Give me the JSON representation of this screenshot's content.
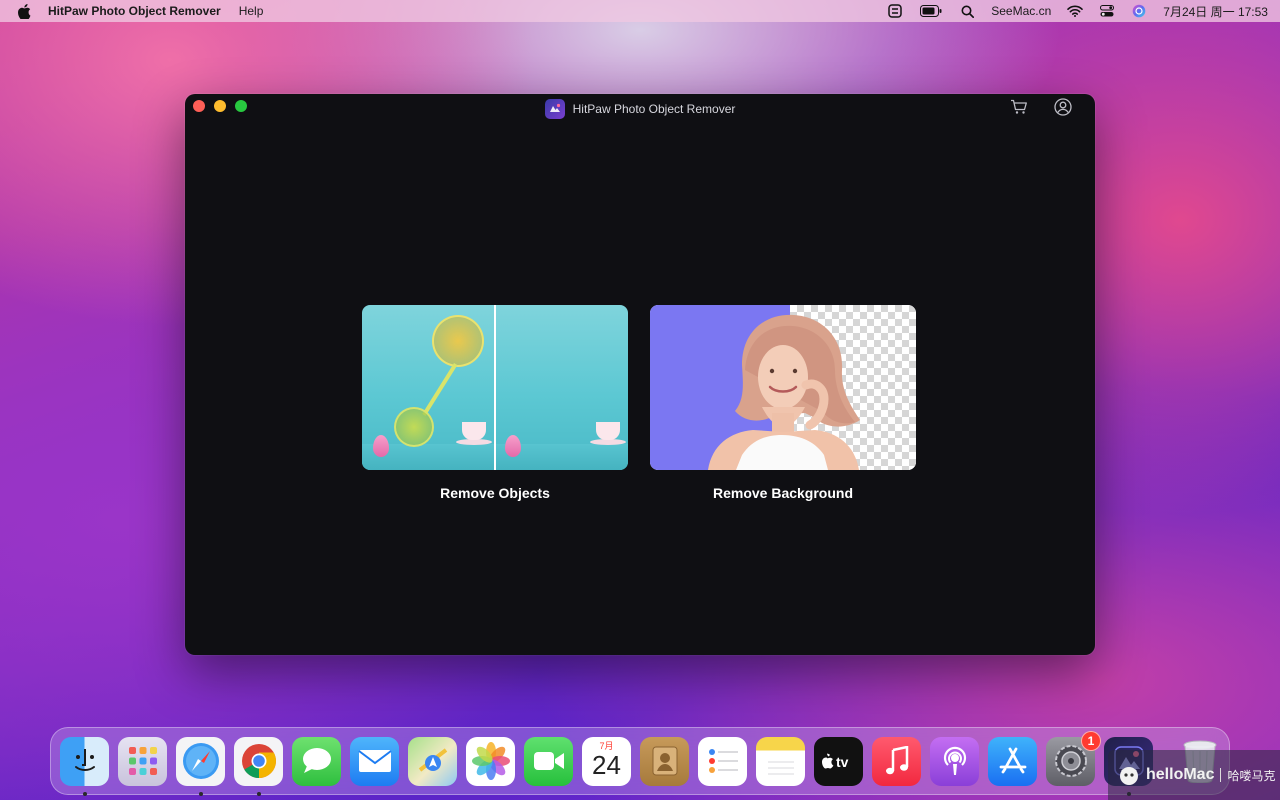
{
  "menubar": {
    "app_name": "HitPaw Photo Object Remover",
    "menus": [
      "Help"
    ],
    "site": "SeeMac.cn",
    "datetime": "7月24日 周一  17:53",
    "icons": [
      "apple-icon",
      "screen-mirror-icon",
      "battery-icon",
      "search-icon",
      "wifi-icon",
      "control-center-icon",
      "siri-icon"
    ]
  },
  "window": {
    "title": "HitPaw Photo Object Remover",
    "icons": [
      "app-logo-icon",
      "cart-icon",
      "account-icon"
    ]
  },
  "features": [
    {
      "label": "Remove Objects"
    },
    {
      "label": "Remove Background"
    }
  ],
  "dock": {
    "calendar_month": "7月",
    "calendar_day": "24",
    "settings_badge": "1",
    "apps": [
      "Finder",
      "Launchpad",
      "Safari",
      "Chrome",
      "Messages",
      "Mail",
      "Maps",
      "Photos",
      "FaceTime",
      "Calendar",
      "Contacts",
      "Reminders",
      "Notes",
      "TV",
      "Music",
      "Podcasts",
      "App Store",
      "System Settings",
      "HitPaw Photo Object Remover",
      "Trash"
    ]
  },
  "watermark": {
    "brand": "helloMac",
    "sub": "哈喽马克"
  },
  "colors": {
    "window_bg": "#0f0f13",
    "close": "#fe5f57",
    "minimize": "#febc2e",
    "maximize": "#28c840",
    "bg_panel_purple": "#7b77f2",
    "badge_red": "#ff3b30"
  }
}
